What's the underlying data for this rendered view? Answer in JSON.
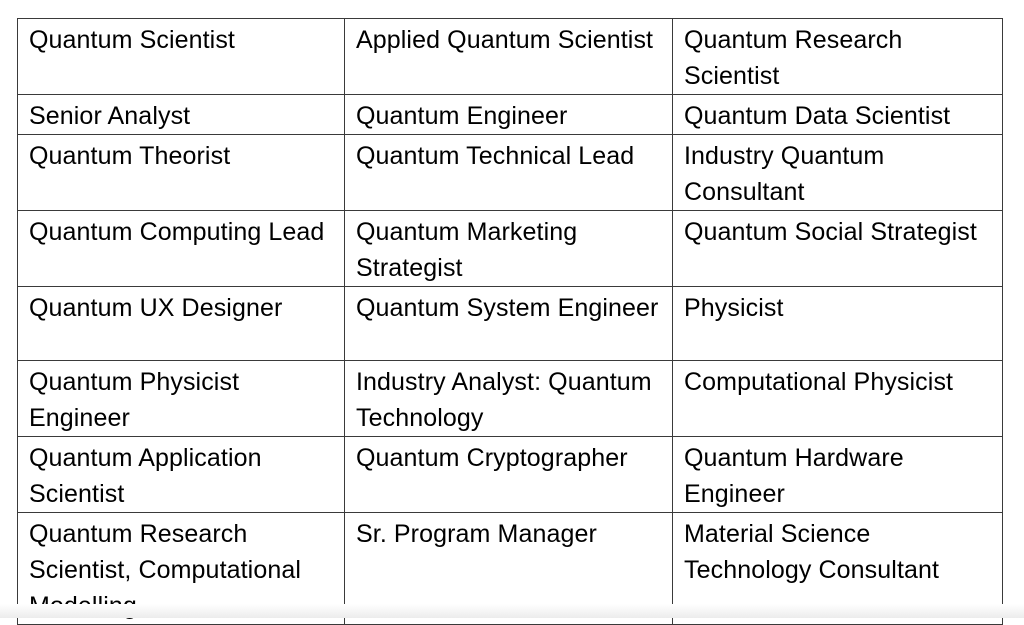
{
  "table": {
    "rows": [
      [
        "Quantum Scientist",
        "Applied Quantum Scientist",
        "Quantum Research Scientist"
      ],
      [
        "Senior Analyst",
        "Quantum Engineer",
        "Quantum Data Scientist"
      ],
      [
        "Quantum Theorist",
        "Quantum Technical Lead",
        "Industry Quantum Consultant"
      ],
      [
        "Quantum Computing Lead",
        "Quantum Marketing Strategist",
        "Quantum Social Strategist"
      ],
      [
        "Quantum UX Designer",
        "Quantum System Engineer",
        "Physicist"
      ],
      [
        "Quantum Physicist Engineer",
        "Industry Analyst: Quantum Technology",
        "Computational Physicist"
      ],
      [
        "Quantum Application Scientist",
        "Quantum Cryptographer",
        "Quantum Hardware Engineer"
      ],
      [
        "Quantum Research Scientist, Computational Modelling",
        "Sr. Program Manager",
        "Material Science Technology Consultant"
      ]
    ]
  }
}
